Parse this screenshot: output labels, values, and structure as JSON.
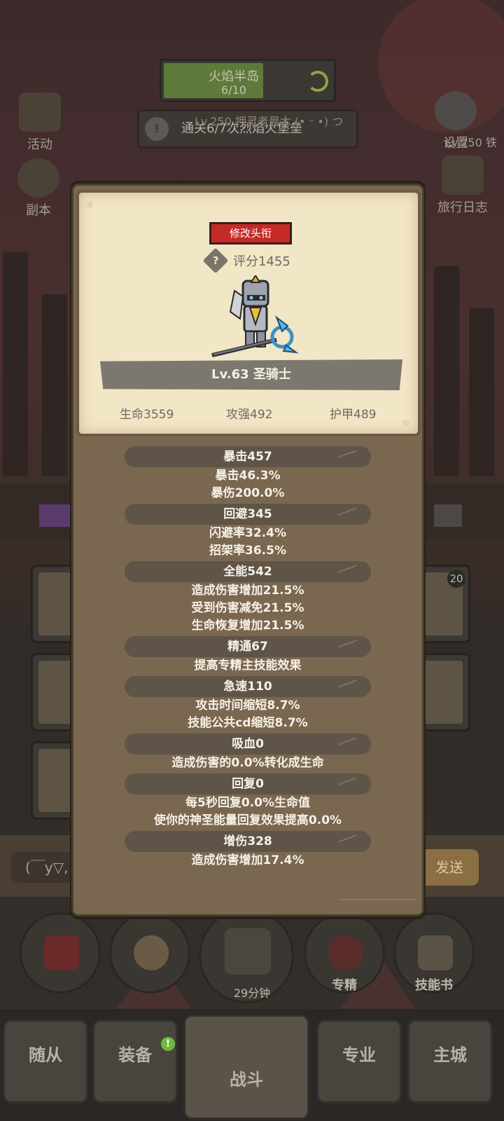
{
  "background": {
    "stage": {
      "title": "火焰半岛",
      "progress": "6/10",
      "progress_fraction": 0.6
    },
    "quest": {
      "text": "通关6/7次烈焰火堡垒",
      "marquee": "Lv.250 押灵者晨木 (• ᵕ •) つ"
    },
    "side_buttons": {
      "activity": "活动",
      "dungeon": "副本",
      "settings": "设置",
      "settings_sub": "Lv.250 铁",
      "travel_log": "旅行日志"
    },
    "slot_badge": "20",
    "chat": {
      "input_placeholder": "(￣y▽,",
      "send_label": "发送"
    },
    "action_buttons": {
      "specialize": "专精",
      "skill_book": "技能书",
      "timer": "29分钟"
    },
    "nav": {
      "followers": "随从",
      "equipment": "装备",
      "battle": "战斗",
      "profession": "专业",
      "main_city": "主城",
      "equipment_badge": "!"
    }
  },
  "modal": {
    "change_title_button": "修改头衔",
    "help_icon": "?",
    "score": "评分1455",
    "level_class": "Lv.63 圣骑士",
    "core_stats": [
      {
        "label": "生命3559"
      },
      {
        "label": "攻强492"
      },
      {
        "label": "护甲489"
      }
    ],
    "stat_groups": [
      {
        "header": "暴击457",
        "lines": [
          "暴击46.3%",
          "暴伤200.0%"
        ]
      },
      {
        "header": "回避345",
        "lines": [
          "闪避率32.4%",
          "招架率36.5%"
        ]
      },
      {
        "header": "全能542",
        "lines": [
          "造成伤害增加21.5%",
          "受到伤害减免21.5%",
          "生命恢复增加21.5%"
        ]
      },
      {
        "header": "精通67",
        "lines": [
          "提高专精主技能效果"
        ]
      },
      {
        "header": "急速110",
        "lines": [
          "攻击时间缩短8.7%",
          "技能公共cd缩短8.7%"
        ]
      },
      {
        "header": "吸血0",
        "lines": [
          "造成伤害的0.0%转化成生命"
        ]
      },
      {
        "header": "回复0",
        "lines": [
          "每5秒回复0.0%生命值",
          "使你的神圣能量回复效果提高0.0%"
        ]
      },
      {
        "header": "增伤328",
        "lines": [
          "造成伤害增加17.4%"
        ]
      }
    ]
  },
  "colors": {
    "parchment": "#f1e6c6",
    "modal_body": "#7a6750",
    "title_button": "#c42b27",
    "stat_header": "#5f5448"
  }
}
